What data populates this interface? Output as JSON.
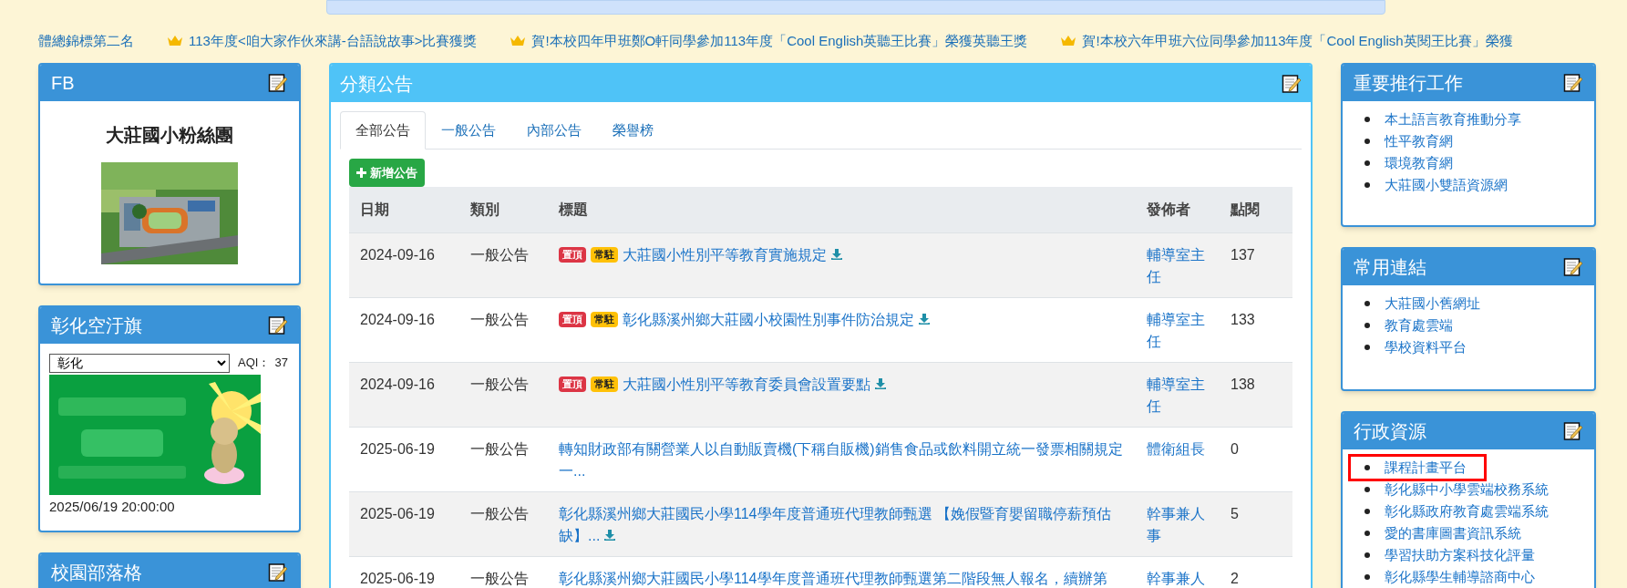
{
  "marquee": [
    {
      "kind": "plain",
      "text": "體總錦標第二名"
    },
    {
      "kind": "crowned",
      "text": "113年度<咱大家作伙來講-台語說故事>比賽獲獎"
    },
    {
      "kind": "crowned",
      "text": "賀!本校四年甲班鄭O軒同學參加113年度「Cool English英聽王比賽」榮獲英聽王獎"
    },
    {
      "kind": "crowned",
      "text": "賀!本校六年甲班六位同學參加113年度「Cool English英閱王比賽」榮獲"
    }
  ],
  "left_panels": [
    {
      "kind": "fb",
      "title": "FB",
      "heading": "大莊國小粉絲團"
    },
    {
      "kind": "aqi",
      "title": "彰化空汙旗",
      "select": "彰化",
      "aqi_label": "AQI：",
      "aqi_value": "37",
      "timestamp": "2025/06/19 20:00:00"
    },
    {
      "kind": "blog",
      "title": "校園部落格"
    }
  ],
  "announcements": {
    "title": "分類公告",
    "tabs": [
      {
        "label": "全部公告",
        "selected": true
      },
      {
        "label": "一般公告",
        "selected": false
      },
      {
        "label": "內部公告",
        "selected": false
      },
      {
        "label": "榮譽榜",
        "selected": false
      }
    ],
    "add_button": "新增公告",
    "columns": [
      "日期",
      "類別",
      "標題",
      "發佈者",
      "點閱"
    ],
    "rows": [
      {
        "date": "2024-09-16",
        "category": "一般公告",
        "badges": [
          {
            "kind": "top",
            "text": "置頂"
          },
          {
            "kind": "pinned",
            "text": "常駐"
          }
        ],
        "title": "大莊國小性別平等教育實施規定",
        "download": true,
        "author": "輔導室主任",
        "views": "137"
      },
      {
        "date": "2024-09-16",
        "category": "一般公告",
        "badges": [
          {
            "kind": "top",
            "text": "置頂"
          },
          {
            "kind": "pinned",
            "text": "常駐"
          }
        ],
        "title": "彰化縣溪州鄉大莊國小校園性別事件防治規定",
        "download": true,
        "author": "輔導室主任",
        "views": "133"
      },
      {
        "date": "2024-09-16",
        "category": "一般公告",
        "badges": [
          {
            "kind": "top",
            "text": "置頂"
          },
          {
            "kind": "pinned",
            "text": "常駐"
          }
        ],
        "title": "大莊國小性別平等教育委員會設置要點",
        "download": true,
        "author": "輔導室主任",
        "views": "138"
      },
      {
        "date": "2025-06-19",
        "category": "一般公告",
        "badges": [],
        "title": "轉知財政部有關營業人以自動販賣機(下稱自販機)銷售食品或飲料開立統一發票相關規定一...",
        "download": false,
        "author": "體衛組長",
        "views": "0"
      },
      {
        "date": "2025-06-19",
        "category": "一般公告",
        "badges": [],
        "title": "彰化縣溪州鄉大莊國民小學114學年度普通班代理教師甄選 【娩假暨育嬰留職停薪預估缺】...",
        "download": true,
        "author": "幹事兼人事",
        "views": "5"
      },
      {
        "date": "2025-06-19",
        "category": "一般公告",
        "badges": [],
        "title": "彰化縣溪州鄉大莊國民小學114學年度普通班代理教師甄選第二階段無人報名，續辦第",
        "download": false,
        "author": "幹事兼人",
        "views": "2"
      }
    ]
  },
  "right_panels": [
    {
      "title": "重要推行工作",
      "links": [
        {
          "text": "本土語言教育推動分享",
          "highlighted": false
        },
        {
          "text": "性平教育網",
          "highlighted": false
        },
        {
          "text": "環境教育網",
          "highlighted": false
        },
        {
          "text": "大莊國小雙語資源網",
          "highlighted": false
        }
      ]
    },
    {
      "title": "常用連結",
      "links": [
        {
          "text": "大莊國小舊網址",
          "highlighted": false
        },
        {
          "text": "教育處雲端",
          "highlighted": false
        },
        {
          "text": "學校資料平台",
          "highlighted": false
        }
      ]
    },
    {
      "title": "行政資源",
      "links": [
        {
          "text": "課程計畫平台",
          "highlighted": true
        },
        {
          "text": "彰化縣中小學雲端校務系統",
          "highlighted": false
        },
        {
          "text": "彰化縣政府教育處雲端系統",
          "highlighted": false
        },
        {
          "text": "愛的書庫圖書資訊系統",
          "highlighted": false
        },
        {
          "text": "學習扶助方案科技化評量",
          "highlighted": false
        },
        {
          "text": "彰化縣學生輔導諮商中心",
          "highlighted": false
        }
      ]
    }
  ]
}
